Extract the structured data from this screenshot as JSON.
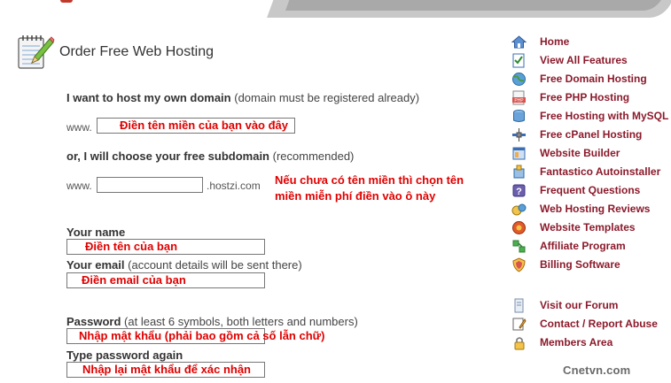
{
  "page": {
    "title": "Order Free Web Hosting"
  },
  "form": {
    "own_domain": {
      "label": "I want to host my own domain",
      "note": "(domain must be registered already)",
      "prefix": "www.",
      "value": "Điền tên miền của bạn vào đây"
    },
    "subdomain": {
      "label": "or, I will choose your free subdomain",
      "note": "(recommended)",
      "prefix": "www.",
      "value": "",
      "suffix": ".hostzi.com",
      "hint_line1": "Nếu chưa có tên miền thì chọn tên",
      "hint_line2": "miền miễn phí điền vào ô này"
    },
    "name": {
      "label": "Your name",
      "value": "Điền tên của bạn"
    },
    "email": {
      "label": "Your email",
      "note": "(account details will be sent there)",
      "value": "Điền email của bạn"
    },
    "password": {
      "label": "Password",
      "note": "(at least 6 symbols, both letters and numbers)",
      "value": "Nhập mật khẩu (phải bao gồm cả số lẫn chữ)"
    },
    "password_again": {
      "label": "Type password again",
      "value": "Nhập lại mật khẩu để xác nhận"
    }
  },
  "sidebar": {
    "items": [
      {
        "label": "Home",
        "icon": "home-icon"
      },
      {
        "label": "View All Features",
        "icon": "checklist-icon"
      },
      {
        "label": "Free Domain Hosting",
        "icon": "globe-icon"
      },
      {
        "label": "Free PHP Hosting",
        "icon": "php-file-icon"
      },
      {
        "label": "Free Hosting with MySQL",
        "icon": "database-icon"
      },
      {
        "label": "Free cPanel Hosting",
        "icon": "satellite-icon"
      },
      {
        "label": "Website Builder",
        "icon": "blocks-icon"
      },
      {
        "label": "Fantastico Autoinstaller",
        "icon": "installer-icon"
      },
      {
        "label": "Frequent Questions",
        "icon": "question-icon"
      },
      {
        "label": "Web Hosting Reviews",
        "icon": "reviews-icon"
      },
      {
        "label": "Website Templates",
        "icon": "template-icon"
      },
      {
        "label": "Affiliate Program",
        "icon": "affiliate-icon"
      },
      {
        "label": "Billing Software",
        "icon": "shield-icon"
      }
    ],
    "secondary": [
      {
        "label": "Visit our Forum",
        "icon": "forum-icon"
      },
      {
        "label": "Contact / Report Abuse",
        "icon": "contact-icon"
      },
      {
        "label": "Members Area",
        "icon": "members-icon"
      }
    ]
  },
  "watermark": "Cnetvn.com",
  "colors": {
    "link": "#8b1a2b",
    "annotation": "#e00000"
  }
}
